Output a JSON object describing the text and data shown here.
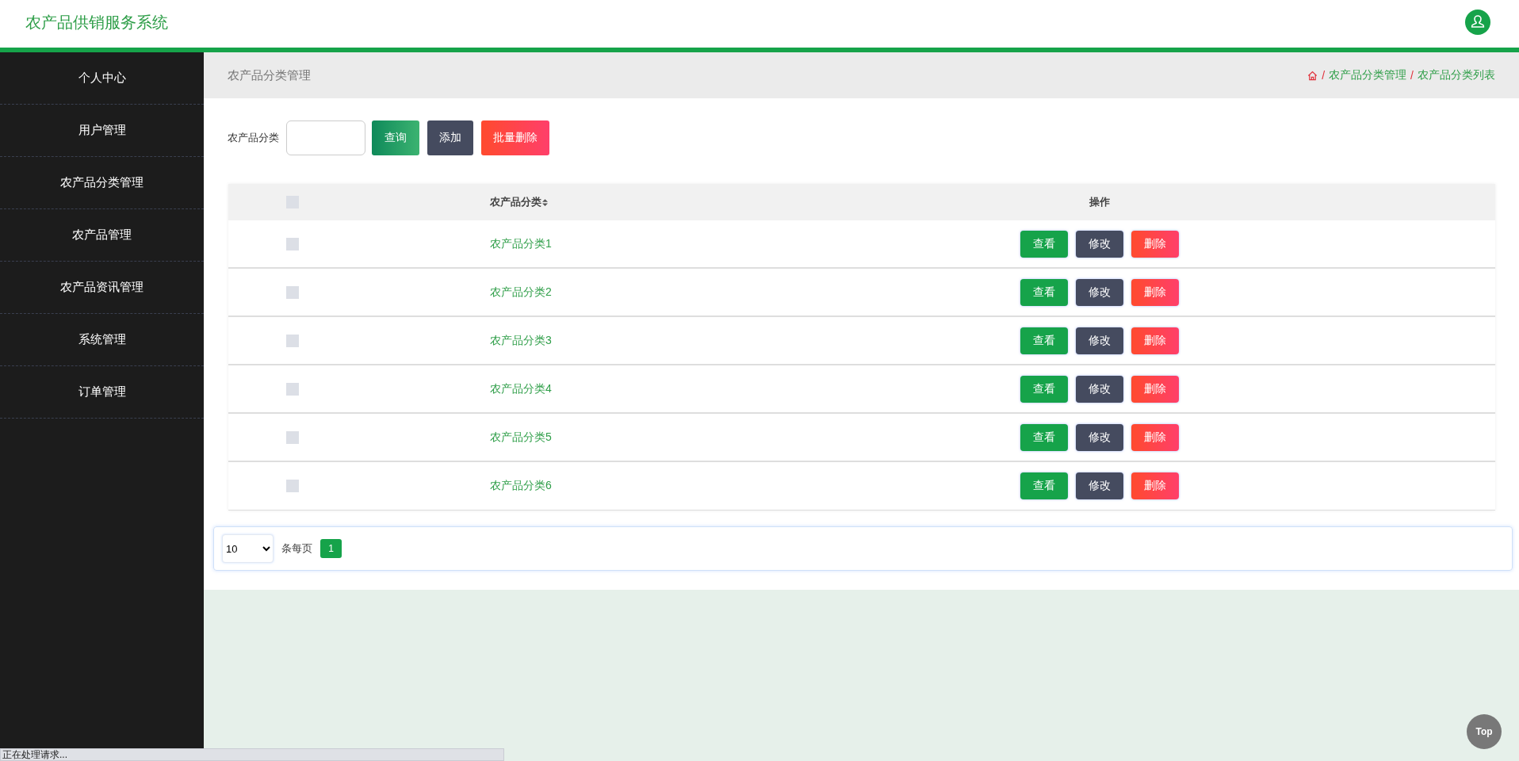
{
  "header": {
    "title": "农产品供销服务系统"
  },
  "sidebar": {
    "items": [
      {
        "label": "个人中心"
      },
      {
        "label": "用户管理"
      },
      {
        "label": "农产品分类管理"
      },
      {
        "label": "农产品管理"
      },
      {
        "label": "农产品资讯管理"
      },
      {
        "label": "系统管理"
      },
      {
        "label": "订单管理"
      }
    ]
  },
  "page_bar": {
    "title": "农产品分类管理",
    "breadcrumb": [
      {
        "separator": "/",
        "label": "农产品分类管理"
      },
      {
        "separator": "/",
        "label": "农产品分类列表"
      }
    ]
  },
  "search": {
    "label": "农产品分类",
    "button": "查询"
  },
  "toolbar_buttons": [
    {
      "label": "添加",
      "kind": "add"
    },
    {
      "label": "批量删除",
      "kind": "delete"
    }
  ],
  "table": {
    "columns": [
      {
        "kind": "check",
        "checked": false
      },
      {
        "label": "农产品分类",
        "kind": "sort"
      },
      {
        "label": "操作",
        "kind": "actions"
      }
    ],
    "rows": [
      {
        "checked": false,
        "name": "农产品分类1",
        "actions": [
          "查看",
          "修改",
          "删除"
        ]
      },
      {
        "checked": false,
        "name": "农产品分类2",
        "actions": [
          "查看",
          "修改",
          "删除"
        ]
      },
      {
        "checked": false,
        "name": "农产品分类3",
        "actions": [
          "查看",
          "修改",
          "删除"
        ]
      },
      {
        "checked": false,
        "name": "农产品分类4",
        "actions": [
          "查看",
          "修改",
          "删除"
        ]
      },
      {
        "checked": false,
        "name": "农产品分类5",
        "actions": [
          "查看",
          "修改",
          "删除"
        ]
      },
      {
        "checked": false,
        "name": "农产品分类6",
        "actions": [
          "查看",
          "修改",
          "删除"
        ]
      }
    ]
  },
  "pagination": {
    "page_size": "10",
    "per_page_label": "条每页",
    "pages": [
      {
        "label": "1",
        "selected": true
      }
    ]
  },
  "back_to_top": "Top",
  "status_bar": "正在处理请求..."
}
